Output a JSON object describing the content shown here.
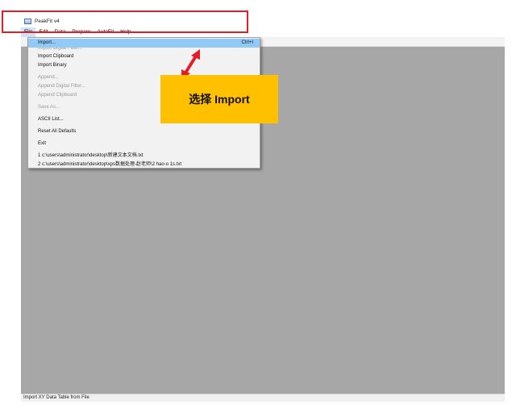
{
  "window": {
    "title": "PeakFit v4",
    "status_text": "Import XY Data Table from File"
  },
  "menubar": {
    "items": [
      {
        "label": "File"
      },
      {
        "label": "Edit"
      },
      {
        "label": "Data"
      },
      {
        "label": "Prepare"
      },
      {
        "label": "AutoFit"
      },
      {
        "label": "Help"
      }
    ]
  },
  "file_menu": {
    "import": {
      "label": "Import...",
      "shortcut": "Ctrl+I"
    },
    "import_digital_filter": "Import Digital Filter...",
    "import_clipboard": "Import Clipboard",
    "import_binary": "Import Binary",
    "append": "Append...",
    "append_digital_filter": "Append Digital Filter...",
    "append_clipboard": "Append Clipboard",
    "save_as": "Save As...",
    "ascii_list": "ASCII List...",
    "reset_all_defaults": "Reset All Defaults",
    "exit": "Exit",
    "recent_1": "1 c:\\users\\administrator\\desktop\\新建文本文档.txt",
    "recent_2": "2 c:\\users\\administrator\\desktop\\xps数据处理-赵老师\\2 hao-o 1s.txt"
  },
  "annotation": {
    "callout_text": "选择 Import",
    "highlight_color": "#e21f26",
    "callout_color": "#ffc000"
  }
}
